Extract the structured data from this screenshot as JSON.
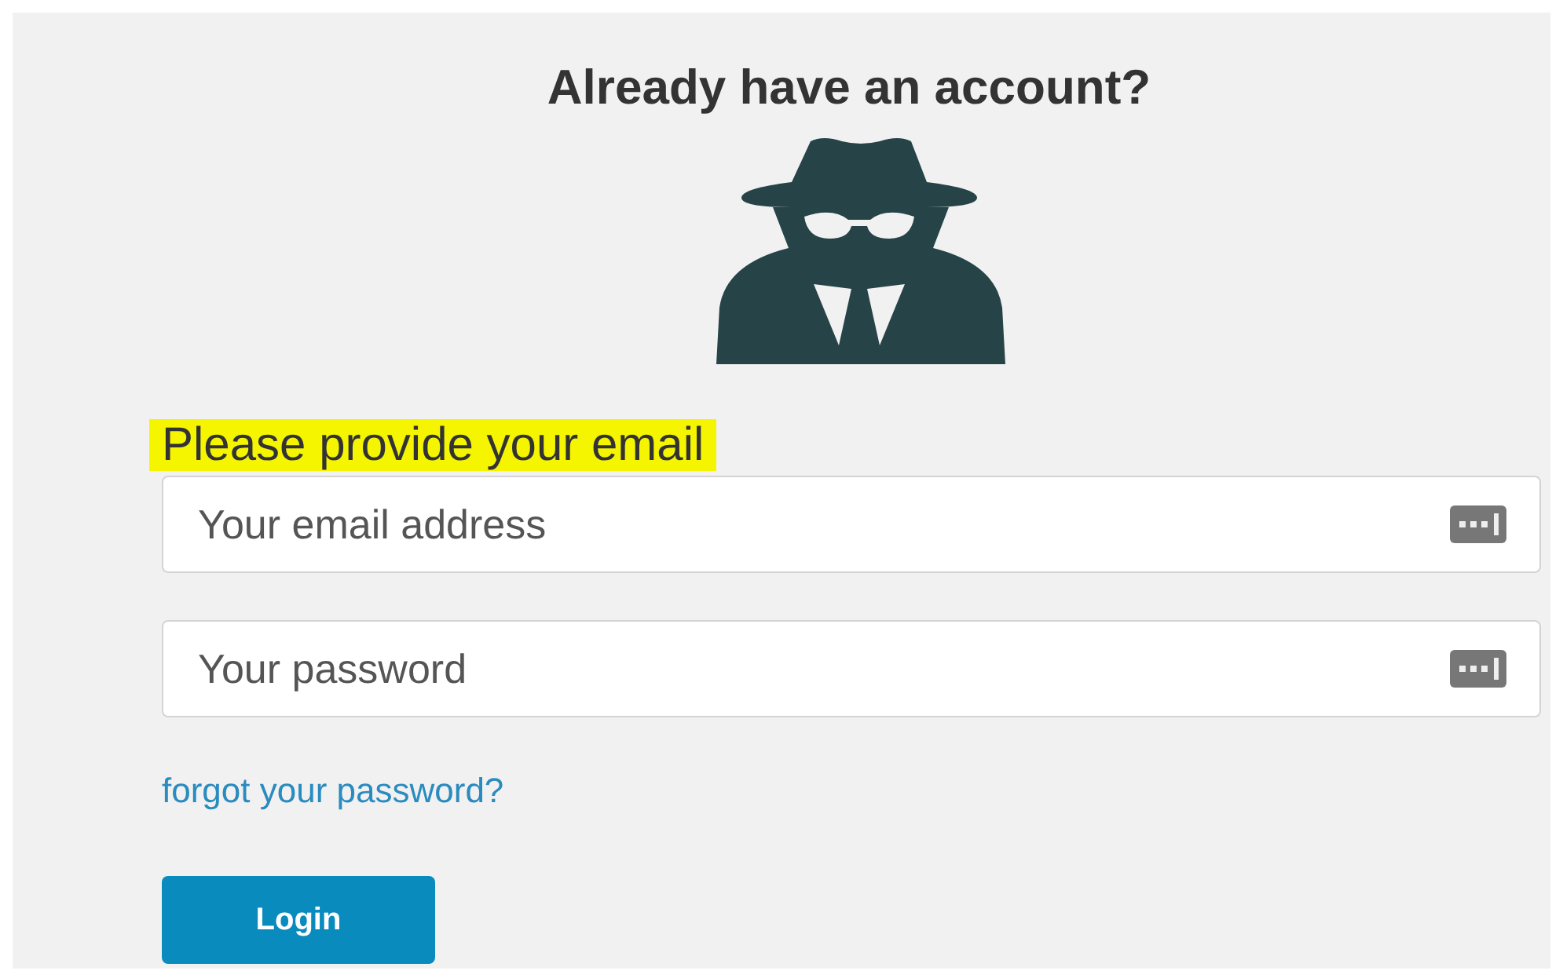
{
  "title": "Already have an account?",
  "email_label": {
    "text": "Please provide your email",
    "highlighted": true
  },
  "fields": [
    {
      "placeholder": "Your email address"
    },
    {
      "placeholder": "Your password"
    }
  ],
  "forgot_link": "forgot your password?",
  "login_button": "Login"
}
